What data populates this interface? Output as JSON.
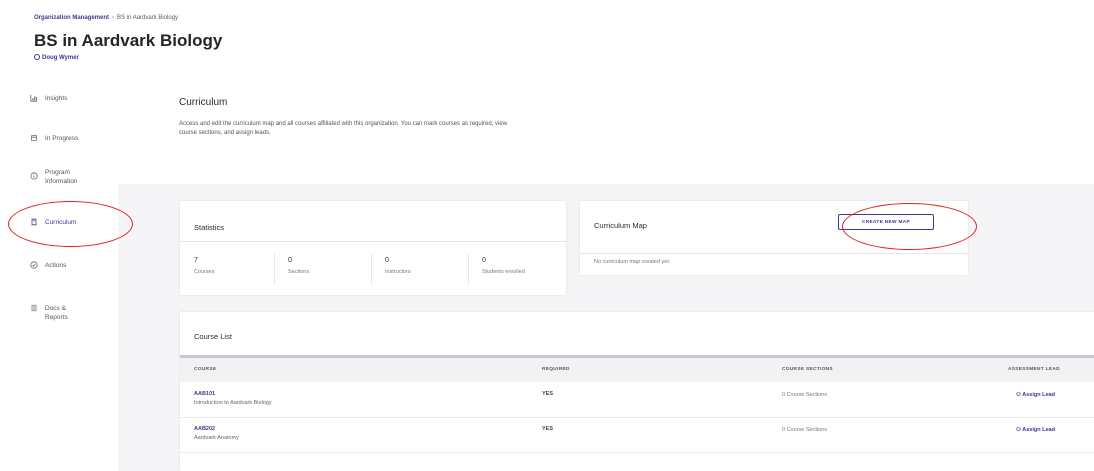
{
  "header": {
    "breadcrumb": {
      "root": "Organization Management",
      "separator": "›",
      "current": "BS in Aardvark Biology"
    },
    "title": "BS in Aardvark Biology",
    "owner": "Doug Wymer"
  },
  "sidebar": {
    "items": [
      {
        "label": "Insights",
        "icon": "bar-chart-icon"
      },
      {
        "label": "In Progress",
        "icon": "box-icon"
      },
      {
        "label": "Program Information",
        "icon": "info-icon"
      },
      {
        "label": "Curriculum",
        "icon": "book-icon",
        "active": true
      },
      {
        "label": "Actions",
        "icon": "check-circle-icon"
      },
      {
        "label": "Docs & Reports",
        "icon": "document-icon"
      }
    ]
  },
  "intro": {
    "title": "Curriculum",
    "description": "Access and edit the curriculum map and all courses affiliated with this organization. You can mark courses as required, view course sections, and assign leads."
  },
  "statistics": {
    "title": "Statistics",
    "items": [
      {
        "value": "7",
        "label": "Courses"
      },
      {
        "value": "0",
        "label": "Sections"
      },
      {
        "value": "0",
        "label": "Instructors"
      },
      {
        "value": "0",
        "label": "Students enrolled"
      }
    ]
  },
  "curriculum_map": {
    "title": "Curriculum Map",
    "create_label": "CREATE NEW MAP",
    "empty_text": "No curriculum map created yet."
  },
  "course_list": {
    "title": "Course List",
    "columns": [
      "COURSE",
      "REQUIRED",
      "COURSE SECTIONS",
      "ASSESSMENT LEAD"
    ],
    "rows": [
      {
        "code": "AAB101",
        "name": "Introduction to Aardvark Biology",
        "required": "YES",
        "sections": "0 Course Sections",
        "lead": "Assign Lead"
      },
      {
        "code": "AAB202",
        "name": "Aardvark Anatomy",
        "required": "YES",
        "sections": "0 Course Sections",
        "lead": "Assign Lead"
      }
    ]
  },
  "colors": {
    "accent": "#3d3a8f",
    "annotation": "#e0201b",
    "background": "#f5f5f7"
  }
}
